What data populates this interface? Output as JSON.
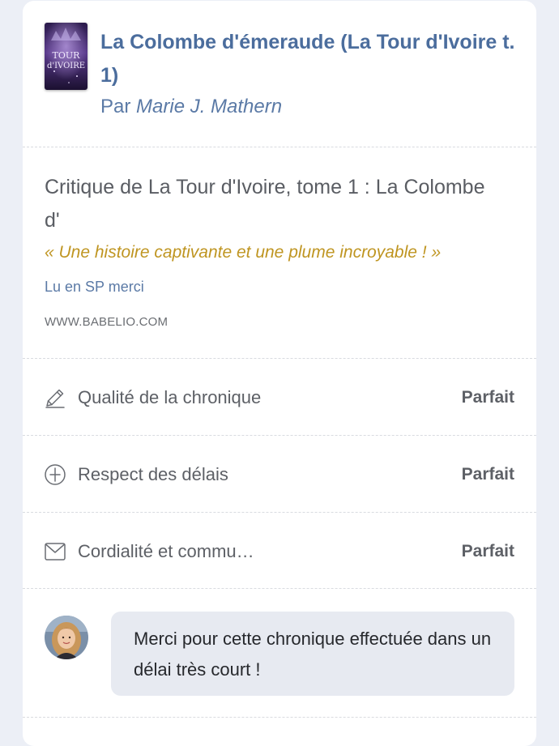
{
  "book": {
    "title": "La Colombe d'émeraude (La Tour d'Ivoire t. 1)",
    "author_prefix": "Par",
    "author_name": "Marie J. Mathern",
    "cover_text": "La TOUR d'IVOIRE"
  },
  "review": {
    "title": "Critique de La Tour d'Ivoire, tome 1 : La Colombe d'",
    "quote": "« Une histoire captivante et une plume incroyable ! »",
    "note": "Lu en SP merci",
    "source": "WWW.BABELIO.COM"
  },
  "ratings": [
    {
      "icon": "pencil-icon",
      "label": "Qualité de la chronique",
      "value": "Parfait"
    },
    {
      "icon": "clock-icon",
      "label": "Respect des délais",
      "value": "Parfait"
    },
    {
      "icon": "envelope-icon",
      "label": "Cordialité et commu…",
      "value": "Parfait"
    }
  ],
  "comment": {
    "text": "Merci pour cette chronique effectuée dans un délai très court !"
  },
  "colors": {
    "background": "#eceff6",
    "title_blue": "#4b6d9d",
    "quote_gold": "#bf9521",
    "bubble": "#e7eaf1"
  }
}
